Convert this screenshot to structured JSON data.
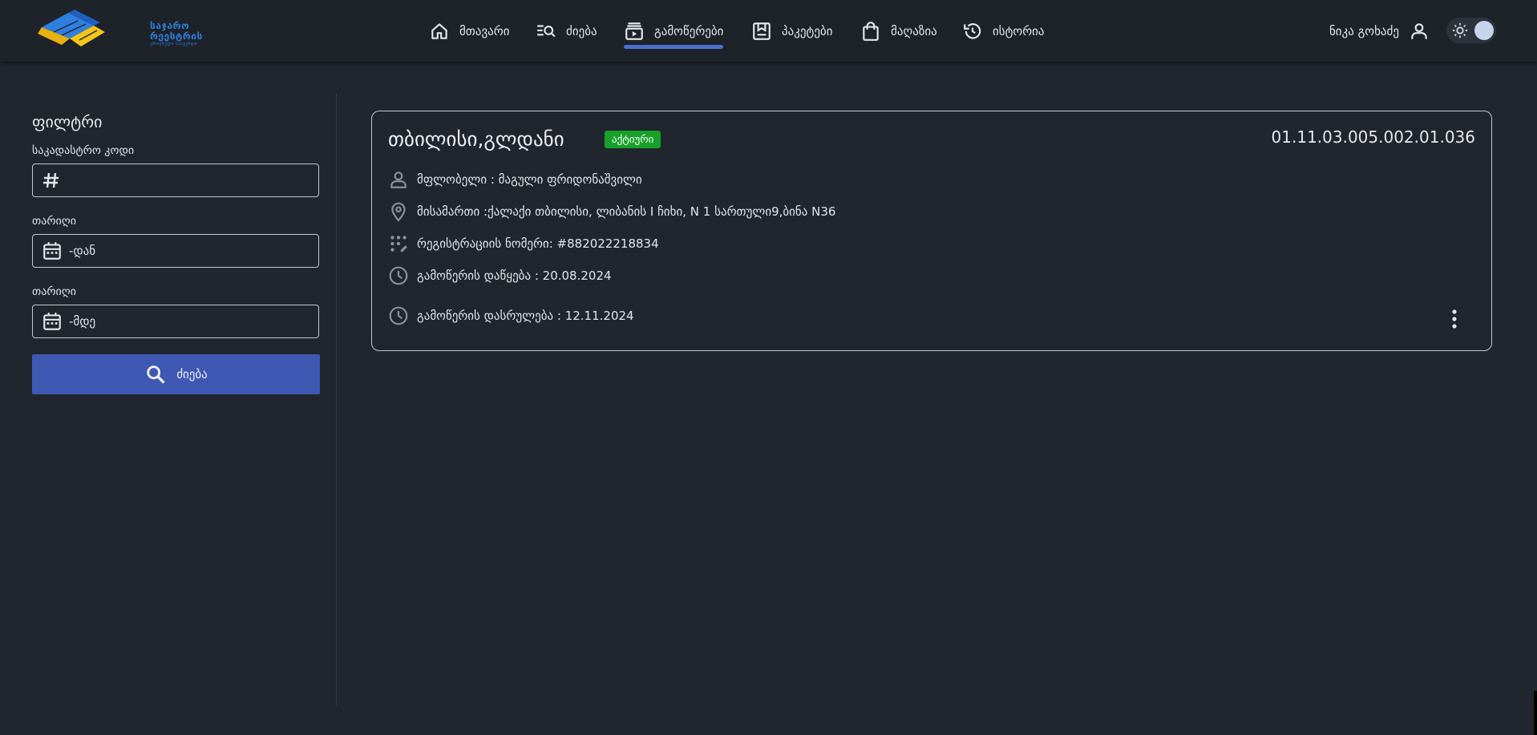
{
  "header": {
    "logo": {
      "line1": "საჯარო",
      "line2": "რეესტრის",
      "line3": "ეროვნული სააგენტო"
    },
    "nav": [
      {
        "label": "მთავარი",
        "icon": "home-icon"
      },
      {
        "label": "ძიება",
        "icon": "search-list-icon"
      },
      {
        "label": "გამოწერები",
        "icon": "subscriptions-icon",
        "active": true
      },
      {
        "label": "პაკეტები",
        "icon": "package-icon"
      },
      {
        "label": "მაღაზია",
        "icon": "shopping-bag-icon"
      },
      {
        "label": "ისტორია",
        "icon": "history-icon"
      }
    ],
    "user_name": "ნიკა გოხაძე",
    "theme_toggle": {
      "state": "dark"
    }
  },
  "filter": {
    "title": "ფილტრი",
    "cadastral_label": "საკადასტრო კოდი",
    "cadastral_value": "",
    "date_from_label": "თარიღი",
    "date_from_placeholder": "-დან",
    "date_to_label": "თარიღი",
    "date_to_placeholder": "-მდე",
    "search_label": "ძიება"
  },
  "results": [
    {
      "title": "თბილისი,გლდანი",
      "status": "აქტიური",
      "code": "01.11.03.005.002.01.036",
      "owner": "მფლობელი : მაგული ფრიდონაშვილი",
      "address": "მისამართი :ქალაქი თბილისი, ლიბანის I ჩიხი, N 1 სართული9,ბინა N36",
      "registration": "რეგისტრაციის ნომერი: #882022218834",
      "start": "გამოწერის დაწყება : 20.08.2024",
      "end": "გამოწერის დასრულება : 12.11.2024"
    }
  ],
  "colors": {
    "background": "#21252d",
    "topbar": "#1e2229",
    "accent": "#3e58b4",
    "indicator": "#4a6fd1",
    "status_active": "#16a12a",
    "logo_blue": "#2f7fe0",
    "logo_yellow": "#f5c518"
  }
}
